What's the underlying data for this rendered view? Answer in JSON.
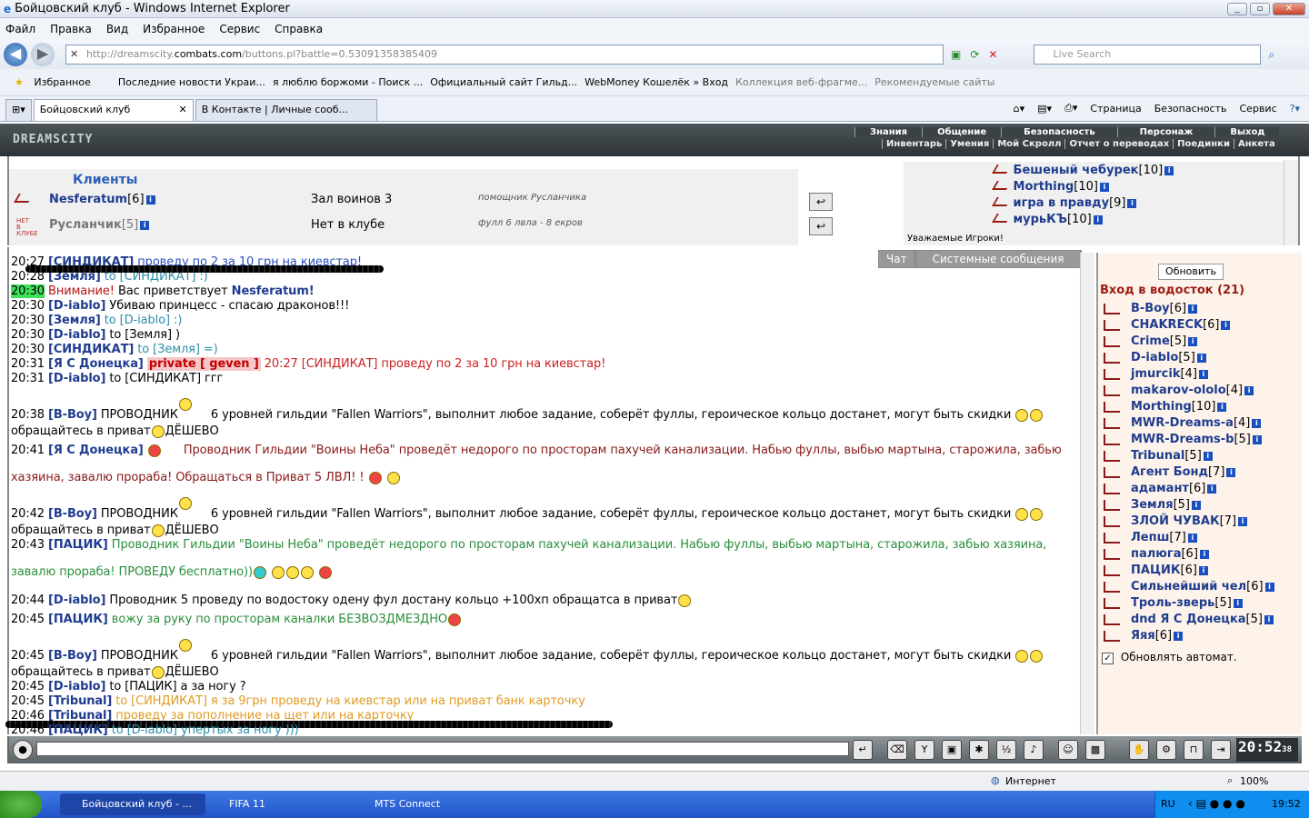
{
  "browser": {
    "title": "Бойцовский клуб - Windows Internet Explorer",
    "menu": [
      "Файл",
      "Правка",
      "Вид",
      "Избранное",
      "Сервис",
      "Справка"
    ],
    "address_host_pre": "http://dreamscity.",
    "address_host": "combats.com",
    "address_path": "/buttons.pl?battle=0.53091358385409",
    "search_placeholder": "Live Search",
    "fav_label": "Избранное",
    "favorites": [
      "Последние новости Украи...",
      "я люблю боржоми - Поиск ...",
      "Официальный сайт Гильд...",
      "WebMoney Кошелёк » Вход",
      "Коллекция веб-фрагме...",
      "Рекомендуемые сайты"
    ],
    "tabs": [
      "Бойцовский клуб",
      "В Контакте | Личные сооб..."
    ],
    "cmd": [
      "Страница",
      "Безопасность",
      "Сервис"
    ],
    "status_zone": "Интернет",
    "zoom": "100%"
  },
  "game": {
    "logo": "DREAMSCITY",
    "top_menu": [
      "Знания",
      "Общение",
      "Безопасность",
      "Персонаж",
      "Выход"
    ],
    "sub_menu": [
      "Инвентарь",
      "Умения",
      "Мой Скролл",
      "Отчет о переводах",
      "Поединки",
      "Анкета"
    ],
    "clients_title": "Клиенты",
    "clients": [
      {
        "name": "Nesferatum",
        "level": "[6]",
        "location": "Зал воинов 3",
        "note": "помощник Русланчика"
      },
      {
        "name": "Русланчик",
        "level": "[5]",
        "location": "Нет в клубе",
        "note": "фулл 6 лвла - 8 екров"
      }
    ],
    "friends": [
      {
        "name": "Бешеный чебурек",
        "level": "[10]"
      },
      {
        "name": "Morthing",
        "level": "[10]"
      },
      {
        "name": "игра в правду",
        "level": "[9]"
      },
      {
        "name": "мурьКЪ",
        "level": "[10]"
      }
    ],
    "friends_note": "Уважаемые Игроки!",
    "chat_tabs": [
      "Чат",
      "Системные сообщения"
    ],
    "refresh_label": "Обновить",
    "room_title": "Вход в водосток (21)",
    "auto_refresh": "Обновлять автомат.",
    "clock": "20:52",
    "clock_sec": "38",
    "players": [
      {
        "name": "B-Boy",
        "level": "[6]"
      },
      {
        "name": "CHAKRECK",
        "level": "[6]"
      },
      {
        "name": "Crime",
        "level": "[5]"
      },
      {
        "name": "D-iablo",
        "level": "[5]"
      },
      {
        "name": "jmurcik",
        "level": "[4]"
      },
      {
        "name": "makarov-ololo",
        "level": "[4]"
      },
      {
        "name": "Morthing",
        "level": "[10]"
      },
      {
        "name": "MWR-Dreams-a",
        "level": "[4]"
      },
      {
        "name": "MWR-Dreams-b",
        "level": "[5]"
      },
      {
        "name": "Tribunal",
        "level": "[5]"
      },
      {
        "name": "Агент Бонд",
        "level": "[7]"
      },
      {
        "name": "адамант",
        "level": "[6]"
      },
      {
        "name": "Земля",
        "level": "[5]"
      },
      {
        "name": "ЗЛОЙ ЧУВАК",
        "level": "[7]"
      },
      {
        "name": "Лепш",
        "level": "[7]"
      },
      {
        "name": "палюга",
        "level": "[6]"
      },
      {
        "name": "ПАЦИК",
        "level": "[6]"
      },
      {
        "name": "Сильнейший чел",
        "level": "[6]"
      },
      {
        "name": "Троль-зверь",
        "level": "[5]"
      },
      {
        "name": "dnd Я С Донецка",
        "level": "[5]"
      },
      {
        "name": "Яяя",
        "level": "[6]"
      }
    ],
    "chat": [
      {
        "t": "20:27",
        "n": "[СИНДИКАТ]",
        "x": "проведу по 2 за 10 грн на киевстар!",
        "c": "blue"
      },
      {
        "t": "20:28",
        "n": "[Земля]",
        "x": "to [СИНДИКАТ] :)",
        "c": "teal"
      },
      {
        "t": "20:30",
        "n": "Внимание!",
        "x": "Вас приветствует",
        "x2": "Nesferatum!",
        "c": "sys"
      },
      {
        "t": "20:30",
        "n": "[D-iablo]",
        "x": "Убиваю принцесс - спасаю драконов!!!",
        "c": "blk"
      },
      {
        "t": "20:30",
        "n": "[Земля]",
        "x": "to [D-iablo] :)",
        "c": "teal"
      },
      {
        "t": "20:30",
        "n": "[D-iablo]",
        "x": "to [Земля] )",
        "c": "blk"
      },
      {
        "t": "20:30",
        "n": "[СИНДИКАТ]",
        "x": "to [Земля] =)",
        "c": "teal"
      },
      {
        "t": "20:31",
        "n": "[Я С Донецка]",
        "p": "private [ geven ]",
        "x": "20:27 [СИНДИКАТ] проведу по 2 за 10 грн на киевстар!",
        "c": "dkred"
      },
      {
        "t": "20:31",
        "n": "[D-iablo]",
        "x": "to [СИНДИКАТ] ггг",
        "c": "blk"
      },
      {
        "t": "20:38",
        "n": "[B-Boy]",
        "x": "ПРОВОДНИК",
        "x2": "6 уровней гильдии \"Fallen Warriors\", выполнит любое задание, соберёт фуллы, героическое кольцо достанет, могут быть скидки",
        "x3": "обращайтесь в приват",
        "x4": "ДЁШЕВО",
        "c": "blk"
      },
      {
        "t": "20:41",
        "n": "[Я С Донецка]",
        "x": "Проводник Гильдии \"Воины Неба\" проведёт недорого по просторам пахучей канализации. Набью фуллы, выбью мартына, старожила, забью",
        "x3": "хазяина, завалю прораба! Обращаться в Приват 5 ЛВЛ! !",
        "c": "dkred"
      },
      {
        "t": "20:42",
        "n": "[B-Boy]",
        "x": "ПРОВОДНИК",
        "x2": "6 уровней гильдии \"Fallen Warriors\", выполнит любое задание, соберёт фуллы, героическое кольцо достанет, могут быть скидки",
        "x3": "обращайтесь в приват",
        "x4": "ДЁШЕВО",
        "c": "blk"
      },
      {
        "t": "20:43",
        "n": "[ПАЦИК]",
        "x": "Проводник Гильдии \"Воины Неба\" проведёт недорого по просторам пахучей канализации. Набью фуллы, выбью мартына, старожила, забью хазяина,",
        "x3": "завалю прораба! ПРОВЕДУ бесплатно))",
        "c": "grn"
      },
      {
        "t": "20:44",
        "n": "[D-iablo]",
        "x": "Проводник 5 проведу по водостоку одену фул достану кольцо +100хп обращатса в приват",
        "c": "blk"
      },
      {
        "t": "20:45",
        "n": "[ПАЦИК]",
        "x": "вожу за руку по просторам каналки БЕЗВОЗДМЕЗДНО",
        "c": "grn"
      },
      {
        "t": "20:45",
        "n": "[B-Boy]",
        "x": "ПРОВОДНИК",
        "x2": "6 уровней гильдии \"Fallen Warriors\", выполнит любое задание, соберёт фуллы, героическое кольцо достанет, могут быть скидки",
        "x3": "обращайтесь в приват",
        "x4": "ДЁШЕВО",
        "c": "blk"
      },
      {
        "t": "20:45",
        "n": "[D-iablo]",
        "x": "to [ПАЦИК] а за ногу ?",
        "c": "blk"
      },
      {
        "t": "20:45",
        "n": "[Tribunal]",
        "x": "to [СИНДИКАТ] я за 9грн проведу на киевстар или на приват банк карточку",
        "c": "org"
      },
      {
        "t": "20:46",
        "n": "[Tribunal]",
        "x": "проведу за пополнение на щет или на карточку",
        "c": "org"
      },
      {
        "t": "20:46",
        "n": "[ПАЦИК]",
        "x": "to [D-iablo] упертых за ногу )))",
        "c": "teal"
      }
    ]
  },
  "taskbar": {
    "tasks": [
      "Бойцовский клуб - ...",
      "FIFA 11",
      "MTS Connect"
    ],
    "lang": "RU",
    "time": "19:52"
  }
}
